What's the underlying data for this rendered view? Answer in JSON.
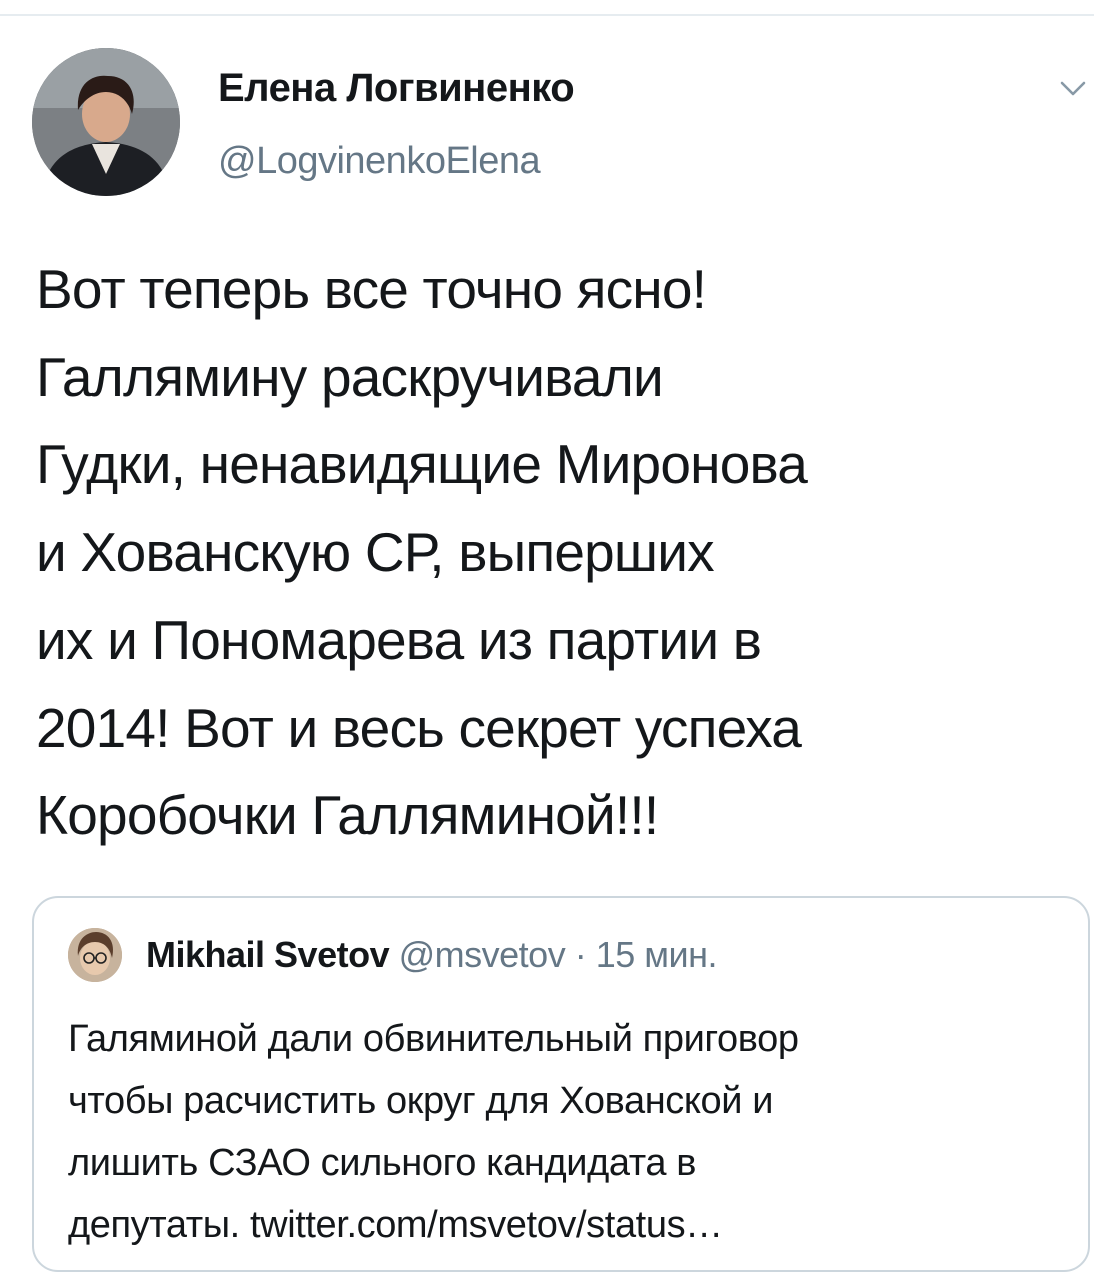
{
  "author": {
    "name": "Елена Логвиненко",
    "handle": "@LogvinenkoElena"
  },
  "tweet": {
    "lines": [
      "Вот теперь все точно ясно!",
      "Галлямину раскручивали",
      "Гудки, ненавидящие Миронова",
      "и Хованскую СР, выперших",
      "их и Пономарева из партии в",
      "2014! Вот и весь секрет успеха",
      "Коробочки Галляминой!!!"
    ]
  },
  "quoted": {
    "name": "Mikhail Svetov",
    "handle": "@msvetov",
    "separator": "·",
    "time": "15 мин.",
    "lines": [
      "Галяминой дали обвинительный приговор",
      "чтобы расчистить округ для Хованской и",
      "лишить СЗАО сильного кандидата в",
      "депутаты. twitter.com/msvetov/status…"
    ]
  },
  "icons": {
    "menu": "chevron-down-icon",
    "author_avatar": "avatar",
    "quoted_avatar": "avatar"
  },
  "colors": {
    "text": "#14171a",
    "secondary": "#657786",
    "border": "#ccd6dd"
  }
}
